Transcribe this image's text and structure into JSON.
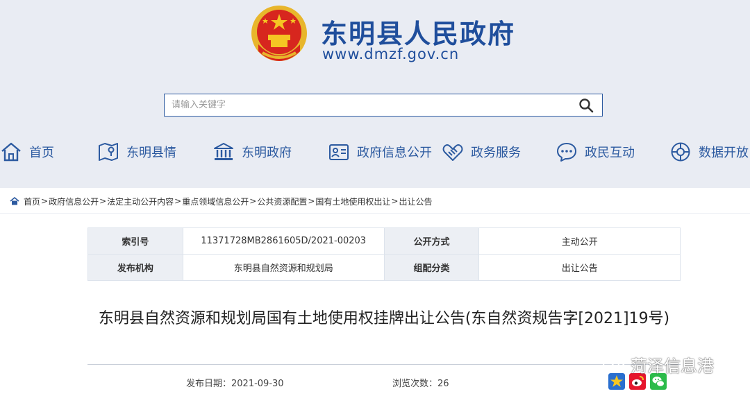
{
  "header": {
    "site_title": "东明县人民政府",
    "site_url": "www.dmzf.gov.cn"
  },
  "search": {
    "placeholder": "请输入关键字"
  },
  "nav": {
    "items": [
      {
        "label": "首页",
        "icon": "home-icon"
      },
      {
        "label": "东明县情",
        "icon": "map-icon"
      },
      {
        "label": "东明政府",
        "icon": "government-building-icon"
      },
      {
        "label": "政府信息公开",
        "icon": "info-card-icon"
      },
      {
        "label": "政务服务",
        "icon": "handshake-icon"
      },
      {
        "label": "政民互动",
        "icon": "chat-icon"
      },
      {
        "label": "数据开放",
        "icon": "data-globe-icon"
      }
    ]
  },
  "breadcrumb": {
    "items": [
      "首页",
      "政府信息公开",
      "法定主动公开内容",
      "重点领域信息公开",
      "公共资源配置",
      "国有土地使用权出让",
      "出让公告"
    ],
    "separator": ">"
  },
  "meta": {
    "index_label": "索引号",
    "index_value": "11371728MB2861605D/2021-00203",
    "method_label": "公开方式",
    "method_value": "主动公开",
    "org_label": "发布机构",
    "org_value": "东明县自然资源和规划局",
    "category_label": "组配分类",
    "category_value": "出让公告"
  },
  "article": {
    "title": "东明县自然资源和规划局国有土地使用权挂牌出让公告(东自然资规告字[2021]19号)",
    "date_label": "发布日期：",
    "date": "2021-09-30",
    "views_label": "浏览次数：",
    "views": "26"
  },
  "share": {
    "icons": [
      "qzone-icon",
      "weibo-icon",
      "wechat-icon"
    ]
  },
  "watermark": {
    "text": "菏泽信息港"
  },
  "colors": {
    "brand": "#1f4e9c",
    "nav": "#2c5aa0",
    "header_bg": "#e9ecf3"
  }
}
